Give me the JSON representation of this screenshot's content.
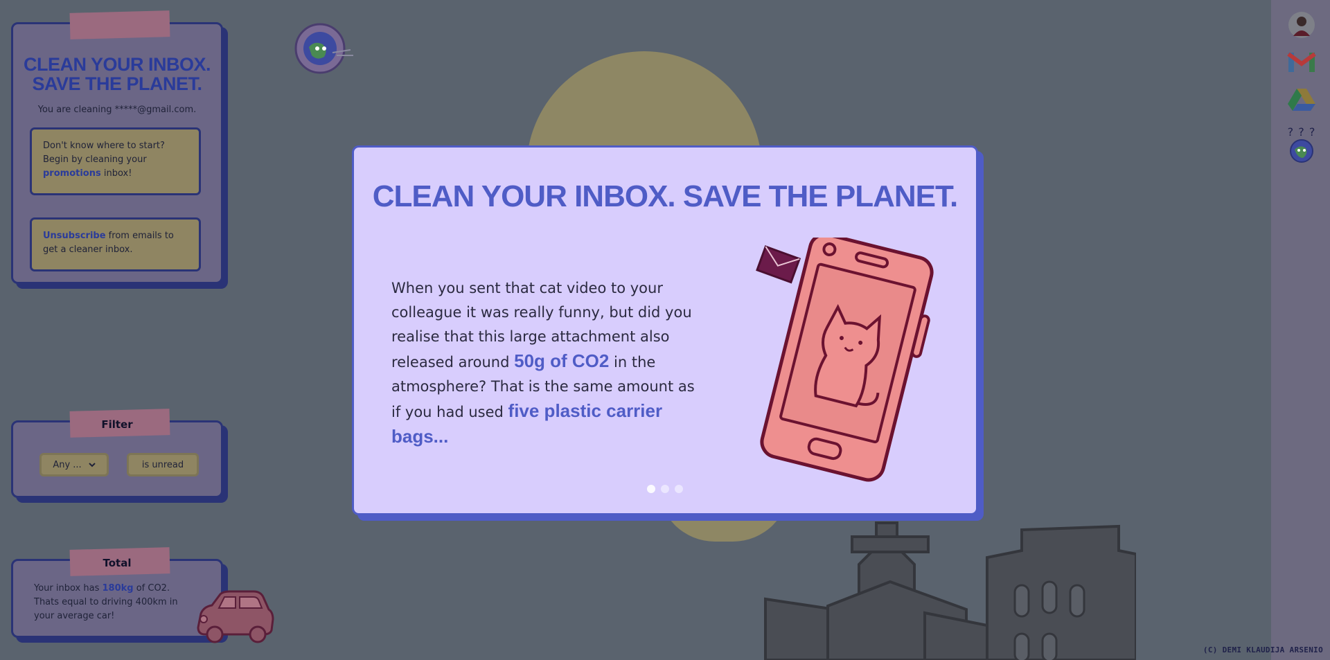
{
  "left_panel": {
    "title_line1": "CLEAN YOUR INBOX.",
    "title_line2": "SAVE THE PLANET.",
    "cleaning_text": "You are cleaning *****@gmail.com.",
    "tip1": {
      "before": "Don't know where to start? Begin by cleaning your ",
      "highlight": "promotions",
      "after": " inbox!"
    },
    "tip2": {
      "highlight": "Unsubscribe",
      "after": " from emails to get a cleaner inbox."
    }
  },
  "filter": {
    "title": "Filter",
    "select_value": "Any ...",
    "unread_label": "is unread"
  },
  "total": {
    "title": "Total",
    "before": "Your inbox has ",
    "highlight": "180kg",
    "after": " of CO2. Thats equal to driving 400km in your average car!"
  },
  "modal": {
    "title": "CLEAN YOUR INBOX. SAVE THE PLANET.",
    "text_part1": "When you sent that cat video to your colleague it was really funny, but did you realise that this large attachment also released around ",
    "highlight1": "50g of CO2",
    "text_part2": " in the atmosphere? That is the same amount as if you had used ",
    "highlight2": "five plastic carrier bags...",
    "dots_total": 3,
    "dot_active": 1
  },
  "right_bar": {
    "icons": [
      "avatar",
      "gmail-icon",
      "google-drive-icon",
      "earth-question-icon"
    ],
    "question_marks": "? ? ?"
  },
  "credit": "(C) DEMI KLAUDIJA ARSENIO",
  "colors": {
    "accent": "#4f5cc6",
    "modal_bg": "#d8cdfd",
    "panel_border": "#2a3376"
  }
}
